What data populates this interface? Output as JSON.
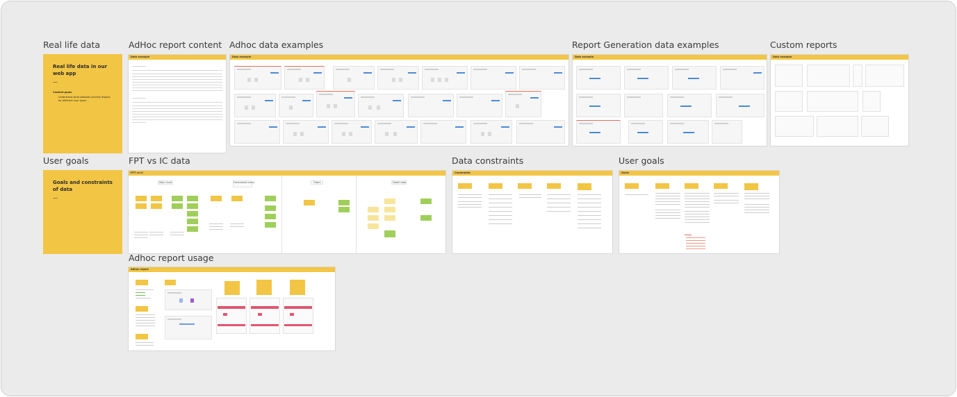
{
  "sections": {
    "real_life_data": "Real life data",
    "adhoc_report_content": "AdHoc report content",
    "adhoc_data_examples": "Adhoc data examples",
    "report_generation_data_examples": "Report Generation data examples",
    "custom_reports": "Custom reports",
    "user_goals_left": "User goals",
    "fpt_vs_ic_data": "FPT vs IC data",
    "data_constraints": "Data constraints",
    "user_goals": "User goals",
    "adhoc_report_usage": "Adhoc report usage"
  },
  "stickies": {
    "real_life": {
      "title": "Real life data in our web app",
      "dash": "—",
      "sub": "Context goals",
      "text": "Understand what datasets actively display for different user types"
    },
    "goals": {
      "title": "Goals and constraints of data",
      "dash": "—"
    }
  },
  "frames": {
    "data_example": "Data example",
    "fpt_vs_ic": "FPT vs IC",
    "constraints": "Constraints",
    "goals": "Goals",
    "adhoc_report": "Adhoc report"
  },
  "fpt_sections": [
    "Main chart",
    "Forecasted event",
    "Filters",
    "Detail data"
  ]
}
